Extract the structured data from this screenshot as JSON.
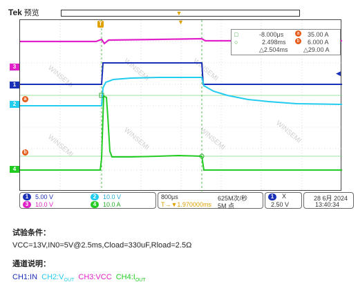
{
  "header": {
    "brand": "Tek",
    "mode": "预览"
  },
  "cursor": {
    "delta_t": "-8.000μs",
    "cursor_time": "2.498ms",
    "delta_time": "△2.504ms",
    "val_a": "35.00 A",
    "val_b": "6.000 A",
    "delta_amp": "△29.00 A",
    "label_a": "a",
    "label_b": "b"
  },
  "channels": [
    {
      "id": "1",
      "scale": "5.00 V",
      "color": "#1a2fb8"
    },
    {
      "id": "2",
      "scale": "10.0 V",
      "color": "#22ccee"
    },
    {
      "id": "3",
      "scale": "10.0 V",
      "color": "#e020c8"
    },
    {
      "id": "4",
      "scale": "10.0 A",
      "color": "#22cc22"
    }
  ],
  "timebase": {
    "scale": "800μs",
    "trigger_pos": "T→▼1.970000ms",
    "sample_rate": "625M次/秒",
    "record": "5M 点"
  },
  "trigger": {
    "channel": "1",
    "symbol": "X",
    "level": "2.50 V"
  },
  "datetime": {
    "date": "28 6月 2024",
    "time": "13:40:34"
  },
  "notes": {
    "conditions_title": "试验条件：",
    "conditions": "VCC=13V,IN0=5V@2.5ms,Cload=330uF,Rload=2.5Ω",
    "channels_title": "通道说明：",
    "ch1": "CH1:IN",
    "ch2_prefix": "CH2:V",
    "ch2_sub": "OUT",
    "ch3": "CH3:VCC",
    "ch4_prefix": "CH4:I",
    "ch4_sub": "OUT"
  },
  "watermark": "WINSEMI"
}
